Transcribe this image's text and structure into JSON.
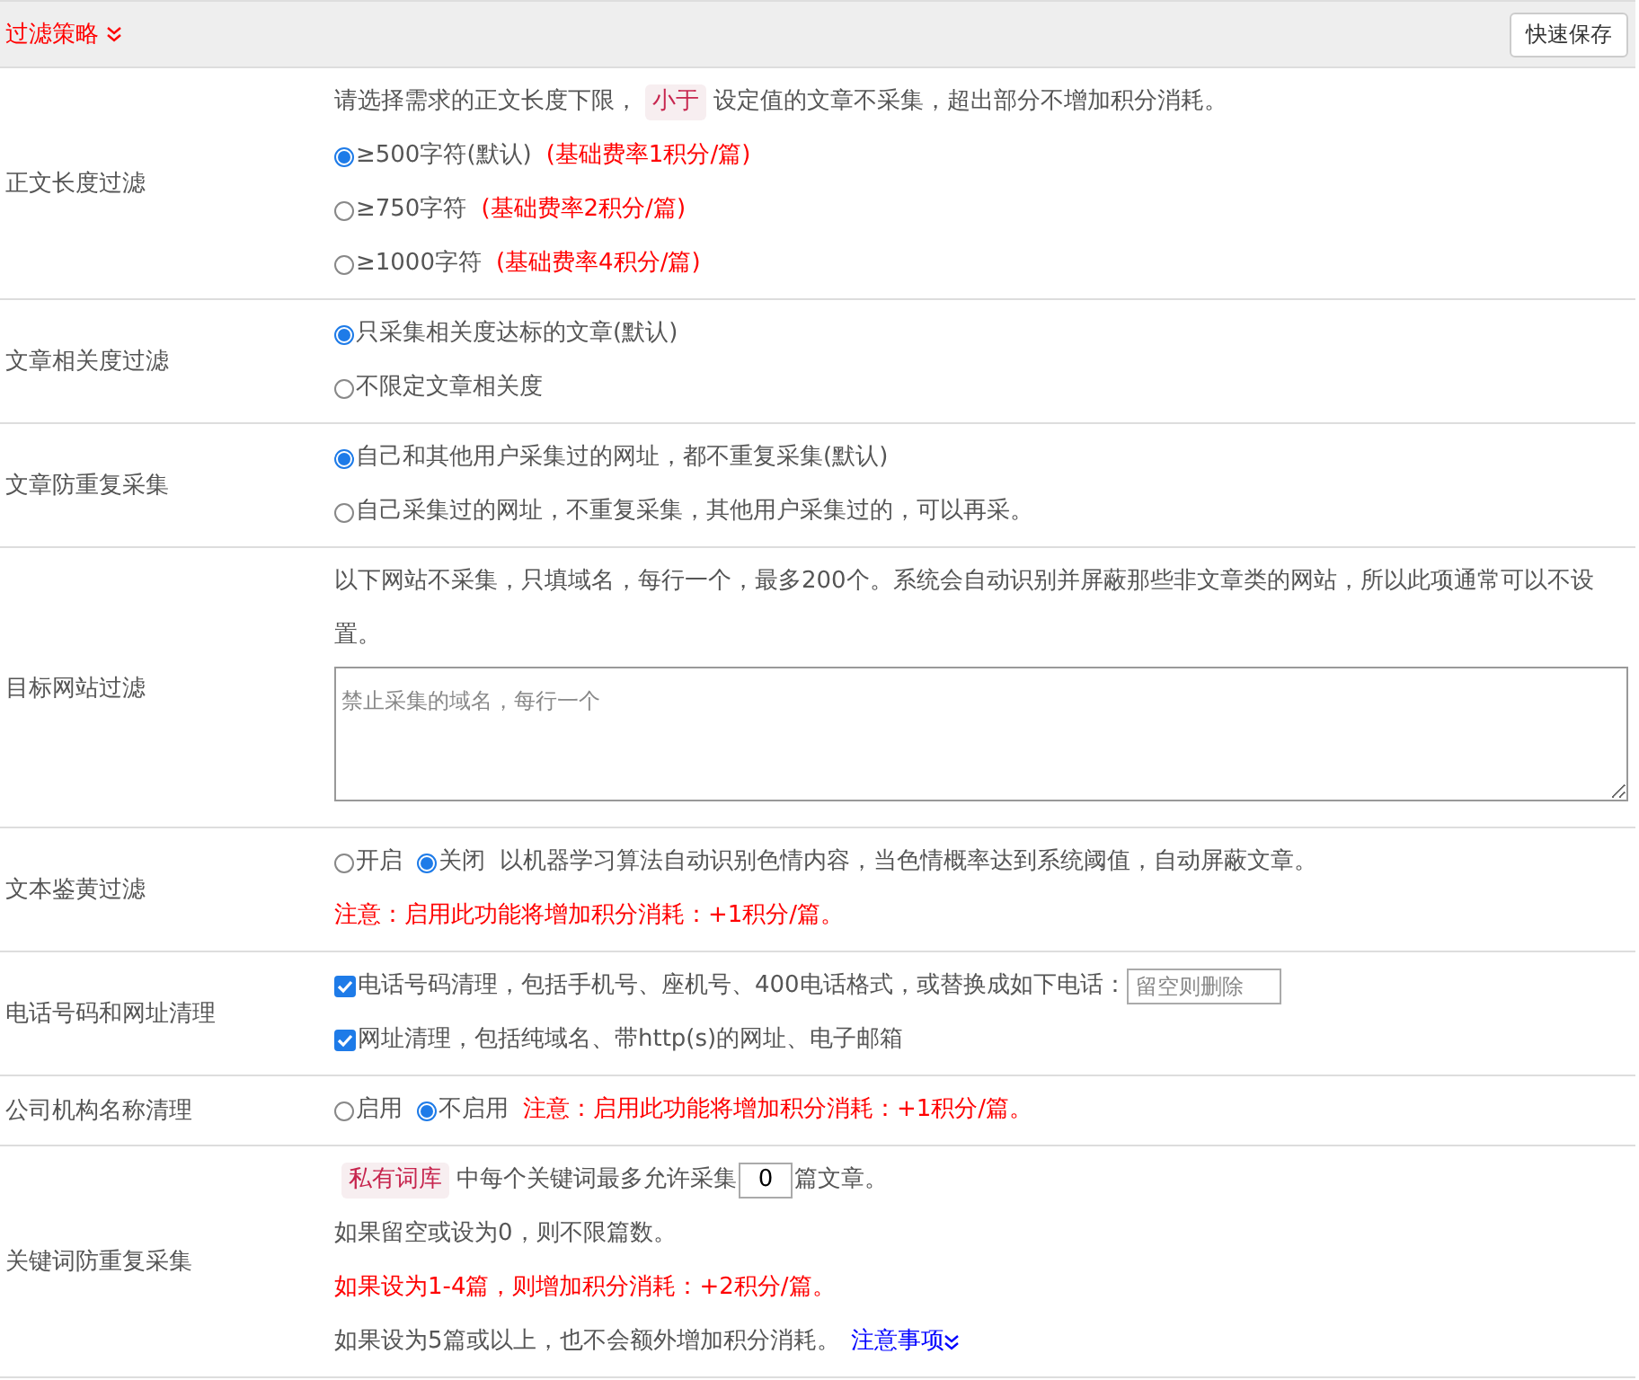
{
  "header": {
    "title": "过滤策略",
    "save_button": "快速保存"
  },
  "rows": [
    {
      "label": "正文长度过滤",
      "lines": [
        [
          {
            "kind": "text",
            "text": "请选择需求的正文长度下限，"
          },
          {
            "kind": "tag",
            "text": "小于"
          },
          {
            "kind": "text",
            "text": "设定值的文章不采集，超出部分不增加积分消耗。"
          }
        ],
        [
          {
            "kind": "radio",
            "text": "≥500字符(默认)",
            "selected": true
          },
          {
            "kind": "note",
            "text": "(基础费率1积分/篇)"
          }
        ],
        [
          {
            "kind": "radio",
            "text": "≥750字符",
            "selected": false
          },
          {
            "kind": "note",
            "text": "(基础费率2积分/篇)"
          }
        ],
        [
          {
            "kind": "radio",
            "text": "≥1000字符",
            "selected": false
          },
          {
            "kind": "note",
            "text": "(基础费率4积分/篇)"
          }
        ]
      ]
    },
    {
      "label": "文章相关度过滤",
      "lines": [
        [
          {
            "kind": "radio",
            "text": "只采集相关度达标的文章(默认)",
            "selected": true
          }
        ],
        [
          {
            "kind": "radio",
            "text": "不限定文章相关度",
            "selected": false
          }
        ]
      ]
    },
    {
      "label": "文章防重复采集",
      "lines": [
        [
          {
            "kind": "radio",
            "text": "自己和其他用户采集过的网址，都不重复采集(默认)",
            "selected": true
          }
        ],
        [
          {
            "kind": "radio",
            "text": "自己采集过的网址，不重复采集，其他用户采集过的，可以再采。",
            "selected": false
          }
        ]
      ]
    },
    {
      "label": "目标网站过滤",
      "lines": [
        [
          {
            "kind": "text",
            "text": "以下网站不采集，只填域名，每行一个，最多200个。系统会自动识别并屏蔽那些非文章类的网站，所以此项通常可以不设置。"
          }
        ],
        [
          {
            "kind": "textarea",
            "placeholder": "禁止采集的域名，每行一个"
          }
        ]
      ]
    },
    {
      "label": "文本鉴黄过滤",
      "lines": [
        [
          {
            "kind": "radio",
            "text": "开启",
            "selected": false
          },
          {
            "kind": "radio",
            "text": "关闭",
            "selected": true
          },
          {
            "kind": "text",
            "text": "以机器学习算法自动识别色情内容，当色情概率达到系统阈值，自动屏蔽文章。"
          }
        ],
        [
          {
            "kind": "note",
            "text": "注意：启用此功能将增加积分消耗：+1积分/篇。"
          }
        ]
      ]
    },
    {
      "label": "电话号码和网址清理",
      "lines": [
        [
          {
            "kind": "checkbox",
            "text": "电话号码清理，包括手机号、座机号、400电话格式，或替换成如下电话：",
            "checked": true
          },
          {
            "kind": "input",
            "placeholder": "留空则删除"
          }
        ],
        [
          {
            "kind": "checkbox",
            "text": "网址清理，包括纯域名、带http(s)的网址、电子邮箱",
            "checked": true
          }
        ]
      ]
    },
    {
      "label": "公司机构名称清理",
      "lines": [
        [
          {
            "kind": "radio",
            "text": "启用",
            "selected": false
          },
          {
            "kind": "radio",
            "text": "不启用",
            "selected": true
          },
          {
            "kind": "note",
            "text": "注意：启用此功能将增加积分消耗：+1积分/篇。"
          }
        ]
      ]
    },
    {
      "label": "关键词防重复采集",
      "lines": [
        [
          {
            "kind": "tag",
            "text": "私有词库"
          },
          {
            "kind": "text",
            "text": "中每个关键词最多允许采集"
          },
          {
            "kind": "number",
            "value": "0"
          },
          {
            "kind": "text",
            "text": "篇文章。"
          }
        ],
        [
          {
            "kind": "text",
            "text": "如果留空或设为0，则不限篇数。"
          }
        ],
        [
          {
            "kind": "note",
            "text": "如果设为1-4篇，则增加积分消耗：+2积分/篇。"
          }
        ],
        [
          {
            "kind": "text",
            "text": "如果设为5篇或以上，也不会额外增加积分消耗。"
          },
          {
            "kind": "link",
            "text": "注意事项"
          }
        ]
      ]
    }
  ]
}
